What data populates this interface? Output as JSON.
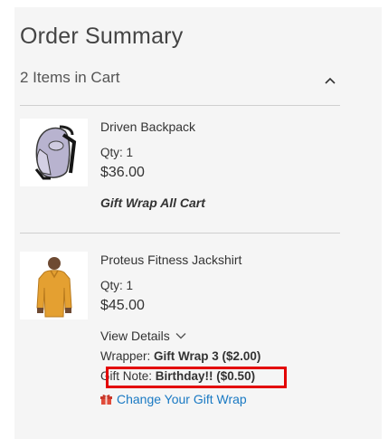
{
  "summary": {
    "title": "Order Summary",
    "items_in_cart": "2 Items in Cart"
  },
  "items": [
    {
      "name": "Driven Backpack",
      "qty": "Qty: 1",
      "price": "$36.00",
      "gift_wrap_label": "Gift Wrap All Cart",
      "thumbnail_icon": "backpack-image"
    },
    {
      "name": "Proteus Fitness Jackshirt",
      "qty": "Qty: 1",
      "price": "$45.00",
      "view_details": "View Details",
      "wrapper_label": "Wrapper:",
      "wrapper_value": "Gift Wrap 3 ($2.00)",
      "gift_note_label": "Gift Note:",
      "gift_note_value": "Birthday!! ($0.50)",
      "change_link": "Change Your Gift Wrap",
      "thumbnail_icon": "jackshirt-image"
    }
  ],
  "colors": {
    "link": "#1979c3",
    "highlight": "#e30000",
    "panel_bg": "#f5f5f5"
  }
}
